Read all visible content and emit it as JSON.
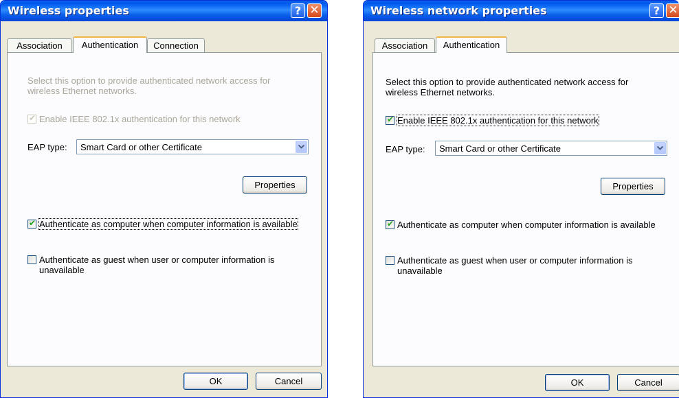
{
  "dialogs": [
    {
      "title": "Wireless properties",
      "tabs": [
        "Association",
        "Authentication",
        "Connection"
      ],
      "active_tab": "Authentication",
      "description_line1": "Select this option to provide authenticated network access for",
      "description_line2": "wireless Ethernet networks.",
      "enable_8021x": {
        "label": "Enable IEEE 802.1x authentication for this network",
        "checked": true,
        "enabled": false
      },
      "eap_type_label": "EAP type:",
      "eap_type_value": "Smart Card or other Certificate",
      "properties_label": "Properties",
      "auth_computer": {
        "label": "Authenticate as computer when computer information is available",
        "checked": true
      },
      "auth_guest": {
        "label_line1": "Authenticate as guest when user or computer information is",
        "label_line2": "unavailable",
        "checked": false
      },
      "ok_label": "OK",
      "cancel_label": "Cancel"
    },
    {
      "title": "Wireless network properties",
      "tabs": [
        "Association",
        "Authentication"
      ],
      "active_tab": "Authentication",
      "description_line1": "Select this option to provide authenticated network access for",
      "description_line2": "wireless Ethernet networks.",
      "enable_8021x": {
        "label": "Enable IEEE 802.1x authentication for this network",
        "checked": true,
        "enabled": true
      },
      "eap_type_label": "EAP type:",
      "eap_type_value": "Smart Card or other Certificate",
      "properties_label": "Properties",
      "auth_computer": {
        "label": "Authenticate as computer when computer information is available",
        "checked": true
      },
      "auth_guest": {
        "label_line1": "Authenticate as guest when user or computer information is",
        "label_line2": "unavailable",
        "checked": false
      },
      "ok_label": "OK",
      "cancel_label": "Cancel"
    }
  ],
  "title_buttons": {
    "help": "?",
    "close": "✕"
  },
  "icons": {
    "help": "help-icon",
    "close": "close-icon",
    "dropdown": "chevron-down-icon",
    "check": "checkmark-icon"
  },
  "colors": {
    "titlebar": "#0a5fe9",
    "dialog_bg": "#ece9d8",
    "active_tab_accent": "#f1b543",
    "checkmark": "#21a121",
    "disabled_text": "#a9a699"
  }
}
